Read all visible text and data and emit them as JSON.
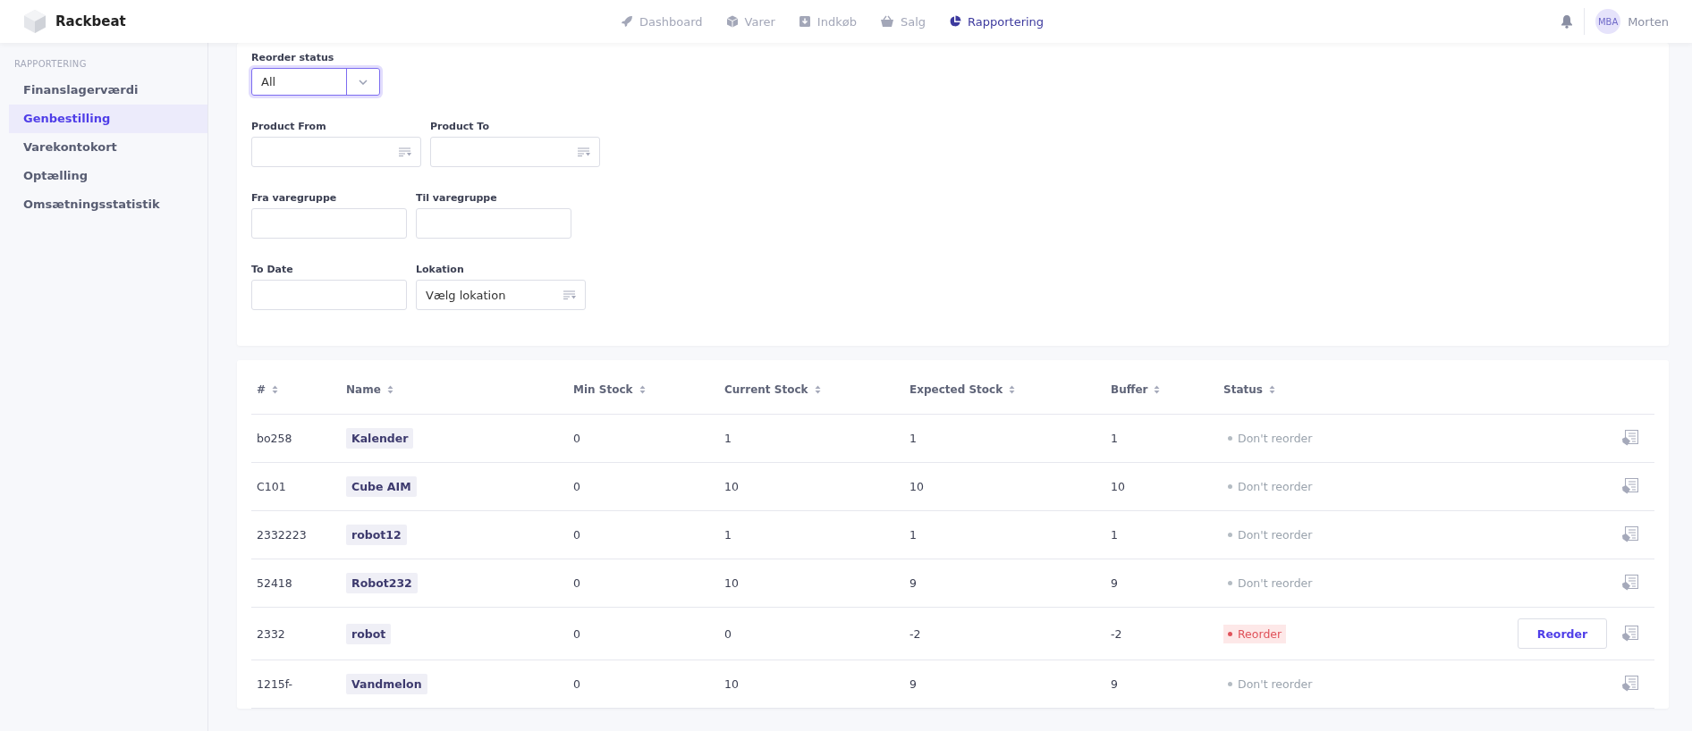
{
  "app": {
    "name": "Rackbeat"
  },
  "nav": [
    {
      "label": "Dashboard",
      "selected": false
    },
    {
      "label": "Varer",
      "selected": false
    },
    {
      "label": "Indkøb",
      "selected": false
    },
    {
      "label": "Salg",
      "selected": false
    },
    {
      "label": "Rapportering",
      "selected": true
    }
  ],
  "user": {
    "initials": "MBA",
    "name": "Morten"
  },
  "sidebar": {
    "heading": "RAPPORTERING",
    "items": [
      {
        "label": "Finanslagerværdi",
        "selected": false
      },
      {
        "label": "Genbestilling",
        "selected": true
      },
      {
        "label": "Varekontokort",
        "selected": false
      },
      {
        "label": "Optælling",
        "selected": false
      },
      {
        "label": "Omsætningsstatistik",
        "selected": false
      }
    ]
  },
  "filters": {
    "reorder_status": {
      "label": "Reorder status",
      "value": "All"
    },
    "rows": [
      [
        {
          "label": "Product From",
          "kind": "picker"
        },
        {
          "label": "Product To",
          "kind": "picker"
        }
      ],
      [
        {
          "label": "Fra varegruppe",
          "kind": "text"
        },
        {
          "label": "Til varegruppe",
          "kind": "text"
        }
      ],
      [
        {
          "label": "To Date",
          "kind": "text"
        },
        {
          "label": "Lokation",
          "kind": "picker",
          "value": "Vælg lokation"
        }
      ]
    ]
  },
  "table": {
    "columns": [
      "#",
      "Name",
      "Min Stock",
      "Current Stock",
      "Expected Stock",
      "Buffer",
      "Status"
    ],
    "rows": [
      {
        "number": "bo258",
        "name": "Kalender",
        "min": "0",
        "current": "1",
        "expected": "1",
        "buffer": "1",
        "status": {
          "kind": "ok",
          "label": "Don't reorder"
        }
      },
      {
        "number": "C101",
        "name": "Cube AIM",
        "min": "0",
        "current": "10",
        "expected": "10",
        "buffer": "10",
        "status": {
          "kind": "ok",
          "label": "Don't reorder"
        }
      },
      {
        "number": "2332223",
        "name": "robot12",
        "min": "0",
        "current": "1",
        "expected": "1",
        "buffer": "1",
        "status": {
          "kind": "ok",
          "label": "Don't reorder"
        }
      },
      {
        "number": "52418",
        "name": "Robot232",
        "min": "0",
        "current": "10",
        "expected": "9",
        "buffer": "9",
        "status": {
          "kind": "ok",
          "label": "Don't reorder"
        }
      },
      {
        "number": "2332",
        "name": "robot",
        "min": "0",
        "current": "0",
        "expected": "-2",
        "buffer": "-2",
        "status": {
          "kind": "reorder",
          "label": "Reorder"
        },
        "action": "Reorder"
      },
      {
        "number": "1215f-",
        "name": "Vandmelon",
        "min": "0",
        "current": "10",
        "expected": "9",
        "buffer": "9",
        "status": {
          "kind": "ok",
          "label": "Don't reorder"
        }
      }
    ]
  }
}
